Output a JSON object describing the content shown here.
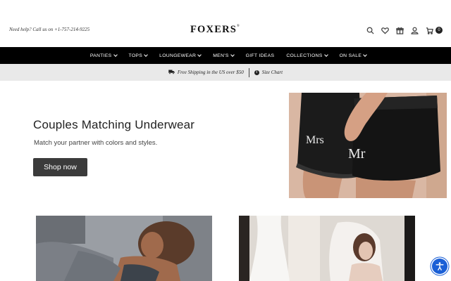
{
  "header": {
    "help_text": "Need help? Call us on +1-757-214-9225",
    "logo": "FOXERS",
    "logo_mark": "®",
    "icons": [
      "search-icon",
      "heart-icon",
      "gift-icon",
      "user-icon",
      "cart-icon"
    ],
    "cart_count": "0"
  },
  "nav": {
    "items": [
      {
        "label": "PANTIES",
        "has_dropdown": true
      },
      {
        "label": "TOPS",
        "has_dropdown": true
      },
      {
        "label": "LOUNGEWEAR",
        "has_dropdown": true
      },
      {
        "label": "MEN'S",
        "has_dropdown": true
      },
      {
        "label": "GIFT IDEAS",
        "has_dropdown": false
      },
      {
        "label": "COLLECTIONS",
        "has_dropdown": true
      },
      {
        "label": "ON SALE",
        "has_dropdown": true
      }
    ]
  },
  "promo": {
    "shipping": "Free Shipping in the US over $50",
    "size_chart": "Size Chart",
    "info_glyph": "i"
  },
  "hero": {
    "title": "Couples Matching Underwear",
    "subtitle": "Match your partner with colors and styles.",
    "button": "Shop now",
    "image_text_left": "Mrs",
    "image_text_right": "Mr"
  },
  "colors": {
    "nav_bg": "#000000",
    "promo_bg": "#e9e9e9",
    "button_bg": "#3b3b3b",
    "accessibility": "#1a5fd6"
  }
}
